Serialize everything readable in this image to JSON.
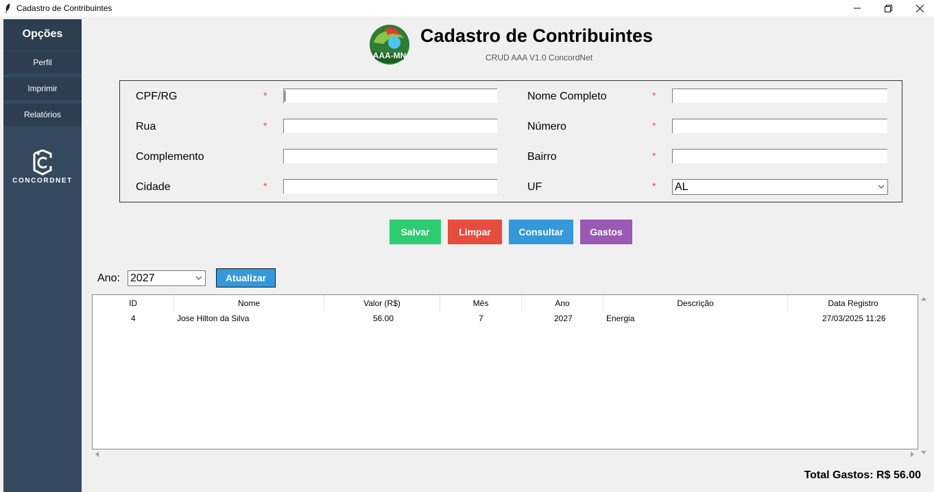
{
  "window": {
    "title": "Cadastro de Contribuintes"
  },
  "sidebar": {
    "heading": "Opções",
    "items": [
      {
        "label": "Perfil"
      },
      {
        "label": "Imprimir"
      },
      {
        "label": "Relatórios"
      }
    ],
    "brand": "CONCORDNET"
  },
  "header": {
    "title": "Cadastro de Contribuintes",
    "subtitle": "CRUD AAA V1.0 ConcordNet",
    "logo_text": "AAA-MN"
  },
  "form": {
    "cpf": {
      "label": "CPF/RG",
      "required_mark": "*",
      "value": ""
    },
    "nome": {
      "label": "Nome Completo",
      "required_mark": "*",
      "value": ""
    },
    "rua": {
      "label": "Rua",
      "required_mark": "*",
      "value": ""
    },
    "numero": {
      "label": "Número",
      "required_mark": "*",
      "value": ""
    },
    "complemento": {
      "label": "Complemento",
      "value": ""
    },
    "bairro": {
      "label": "Bairro",
      "required_mark": "*",
      "value": ""
    },
    "cidade": {
      "label": "Cidade",
      "required_mark": "*",
      "value": ""
    },
    "uf": {
      "label": "UF",
      "required_mark": "*",
      "value": "AL"
    }
  },
  "actions": {
    "salvar": "Salvar",
    "limpar": "Limpar",
    "consultar": "Consultar",
    "gastos": "Gastos"
  },
  "filter": {
    "ano_label": "Ano:",
    "ano_value": "2027",
    "atualizar": "Atualizar"
  },
  "table": {
    "columns": [
      "ID",
      "Nome",
      "Valor (R$)",
      "Mês",
      "Ano",
      "Descrição",
      "Data Registro"
    ],
    "rows": [
      {
        "id": "4",
        "nome": "Jose Hilton da Silva",
        "valor": "56.00",
        "mes": "7",
        "ano": "2027",
        "descricao": "Energia",
        "data": "27/03/2025 11:26"
      }
    ]
  },
  "total": "Total Gastos: R$ 56.00",
  "colors": {
    "sidebar": "#34495e",
    "sidebar_item": "#2c3e50",
    "salvar": "#2ecc71",
    "limpar": "#e74c3c",
    "consultar": "#3498db",
    "gastos": "#9b59b6",
    "required": "#e74c3c"
  },
  "icons": [
    "feather-icon",
    "minimize-icon",
    "restore-icon",
    "close-icon",
    "concordnet-logo-icon",
    "aaa-mn-logo",
    "chevron-down-icon"
  ]
}
